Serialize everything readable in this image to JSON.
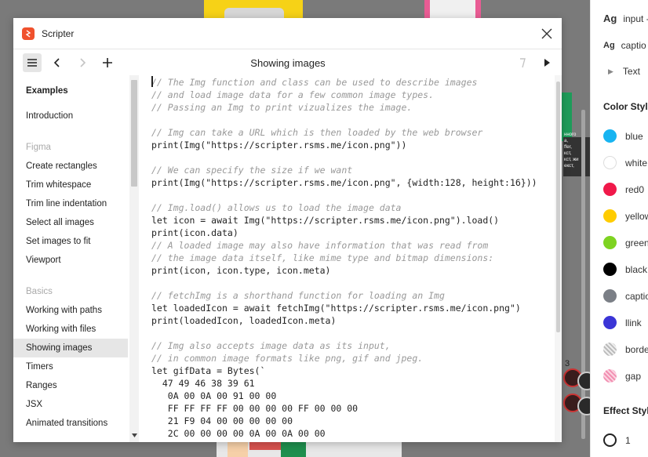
{
  "window": {
    "app_title": "Scripter",
    "doc_title": "Showing images"
  },
  "sidebar": {
    "items": [
      {
        "label": "Examples"
      },
      {
        "label": "Introduction"
      },
      {
        "label": "Figma"
      },
      {
        "label": "Create rectangles"
      },
      {
        "label": "Trim whitespace"
      },
      {
        "label": "Trim line indentation"
      },
      {
        "label": "Select all images"
      },
      {
        "label": "Set images to fit"
      },
      {
        "label": "Viewport"
      },
      {
        "label": "Basics"
      },
      {
        "label": "Working with paths"
      },
      {
        "label": "Working with files"
      },
      {
        "label": "Showing images"
      },
      {
        "label": "Timers"
      },
      {
        "label": "Ranges"
      },
      {
        "label": "JSX"
      },
      {
        "label": "Animated transitions"
      }
    ]
  },
  "code_lines": [
    "// The Img function and class can be used to describe images",
    "// and load image data for a few common image types.",
    "// Passing an Img to print vizualizes the image.",
    "",
    "// Img can take a URL which is then loaded by the web browser",
    "print(Img(\"https://scripter.rsms.me/icon.png\"))",
    "",
    "// We can specify the size if we want",
    "print(Img(\"https://scripter.rsms.me/icon.png\", {width:128, height:16}))",
    "",
    "// Img.load() allows us to load the image data",
    "let icon = await Img(\"https://scripter.rsms.me/icon.png\").load()",
    "print(icon.data)",
    "// A loaded image may also have information that was read from",
    "// the image data itself, like mime type and bitmap dimensions:",
    "print(icon, icon.type, icon.meta)",
    "",
    "// fetchImg is a shorthand function for loading an Img",
    "let loadedIcon = await fetchImg(\"https://scripter.rsms.me/icon.png\")",
    "print(loadedIcon, loadedIcon.meta)",
    "",
    "// Img also accepts image data as its input,",
    "// in common image formats like png, gif and jpeg.",
    "let gifData = Bytes(`",
    "  47 49 46 38 39 61",
    "   0A 00 0A 00 91 00 00",
    "   FF FF FF FF 00 00 00 00 FF 00 00 00",
    "   21 F9 04 00 00 00 00 00",
    "   2C 00 00 00 00 0A 00 0A 00 00"
  ],
  "right_panel": {
    "text_styles": [
      {
        "label": "input -"
      },
      {
        "label": "captio"
      },
      {
        "label": "Text"
      }
    ],
    "color_styles_heading": "Color Style",
    "colors": [
      {
        "label": "blue",
        "color": "#18b4f1"
      },
      {
        "label": "white",
        "color": "#ffffff"
      },
      {
        "label": "red0",
        "color": "#f0194a"
      },
      {
        "label": "yellow",
        "color": "#ffcc00"
      },
      {
        "label": "green",
        "color": "#7ed321"
      },
      {
        "label": "black",
        "color": "#000000"
      },
      {
        "label": "captio",
        "color": "#7b7f86"
      },
      {
        "label": "llink",
        "color": "#3b35d6"
      },
      {
        "label": "border",
        "color": "#cccccc"
      },
      {
        "label": "gap",
        "color": "#f28fb1"
      }
    ],
    "effect_styles_heading": "Effect Style",
    "effect_item": "1"
  },
  "canvas": {
    "number_label": "3",
    "tiny_text": "нного\nа,\nffer,\nкст,\nкст, жи\nекст,"
  }
}
